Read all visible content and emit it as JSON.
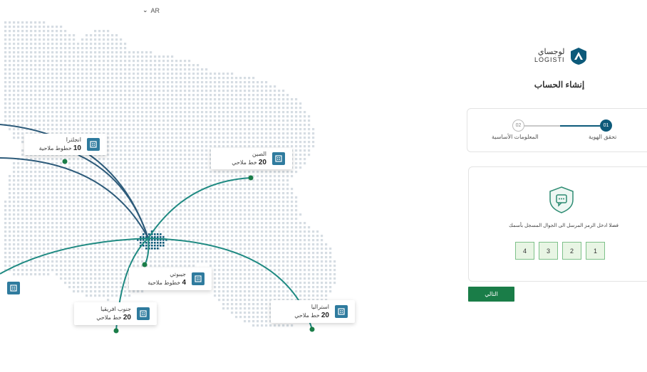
{
  "language": {
    "label": "AR"
  },
  "brand": {
    "name_ar": "لوجساي",
    "name_en": "LOGISTI"
  },
  "page_title": "إنشاء الحساب",
  "steps": [
    {
      "number": "01",
      "label": "تحقق الهوية",
      "state": "active"
    },
    {
      "number": "02",
      "label": "المعلومات الأساسية",
      "state": "inactive"
    }
  ],
  "otp": {
    "message": "فضلا ادخل الرمز المرسل الى الجوال المسجل بأسمك",
    "digits": [
      "1",
      "2",
      "3",
      "4"
    ]
  },
  "next_button": "التالي",
  "routes": [
    {
      "country": "انجلترا",
      "count": "10",
      "unit": "خطوط ملاحية"
    },
    {
      "country": "الصين",
      "count": "20",
      "unit": "خط ملاحي"
    },
    {
      "country": "جيبوتي",
      "count": "4",
      "unit": "خطوط ملاحية"
    },
    {
      "country": "جنوب افريقيا",
      "count": "20",
      "unit": "خط ملاحي"
    },
    {
      "country": "استراليا",
      "count": "20",
      "unit": "خط ملاحي"
    }
  ],
  "colors": {
    "primary": "#0d5a7a",
    "accent": "#1a7d48",
    "route_teal": "#1f8a82",
    "route_navy": "#2d5b7a",
    "map_dots": "#d6dde3"
  }
}
